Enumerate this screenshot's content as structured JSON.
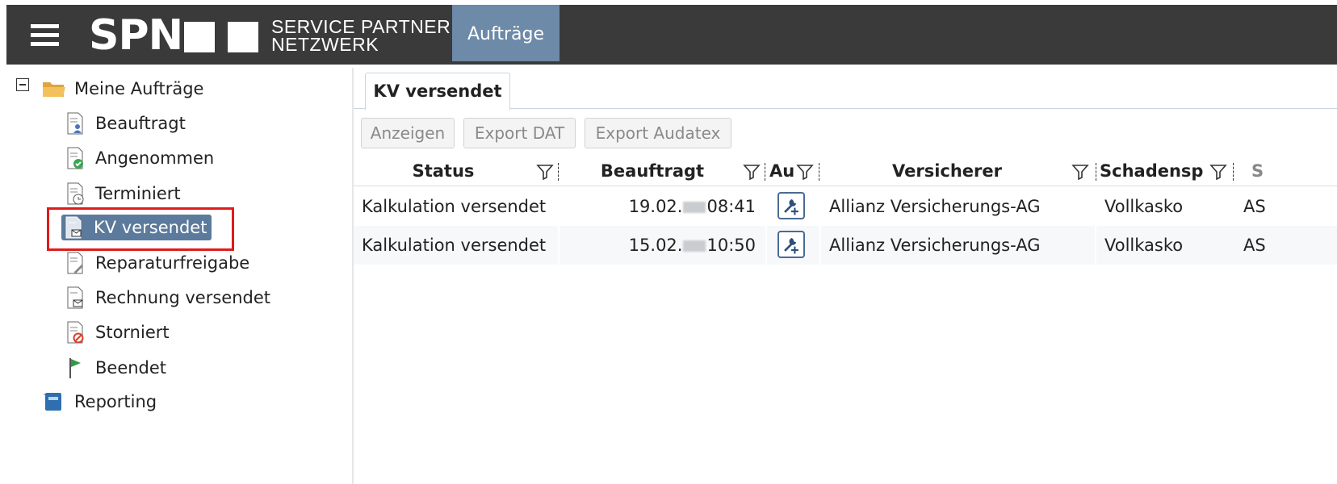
{
  "header": {
    "logo_text": "SPN",
    "logo_sub_line1": "SERVICE PARTNER",
    "logo_sub_line2": "NETZWERK",
    "nav_tab": "Aufträge"
  },
  "tree": {
    "root": "Meine Aufträge",
    "items": [
      {
        "label": "Beauftragt",
        "icon": "doc-person-icon"
      },
      {
        "label": "Angenommen",
        "icon": "doc-check-icon"
      },
      {
        "label": "Terminiert",
        "icon": "doc-clock-icon"
      },
      {
        "label": "KV versendet",
        "icon": "doc-mail-icon",
        "selected": true
      },
      {
        "label": "Reparaturfreigabe",
        "icon": "doc-pen-icon"
      },
      {
        "label": "Rechnung versendet",
        "icon": "doc-mail-icon"
      },
      {
        "label": "Storniert",
        "icon": "doc-cancel-icon"
      },
      {
        "label": "Beendet",
        "icon": "green-flag-icon"
      }
    ],
    "reporting": "Reporting"
  },
  "tab": {
    "label": "KV versendet"
  },
  "toolbar": {
    "anzeigen": "Anzeigen",
    "export_dat": "Export DAT",
    "export_audatex": "Export Audatex"
  },
  "table": {
    "columns": {
      "status": "Status",
      "beauftragt": "Beauftragt",
      "au": "Au",
      "versicherer": "Versicherer",
      "schadensparte": "Schadensp",
      "next": "S"
    },
    "rows": [
      {
        "status": "Kalkulation versendet",
        "date": "19.02.",
        "time": "08:41",
        "versicherer": "Allianz Versicherungs-AG",
        "schaden": "Vollkasko",
        "next": "AS"
      },
      {
        "status": "Kalkulation versendet",
        "date": "15.02.",
        "time": "10:50",
        "versicherer": "Allianz Versicherungs-AG",
        "schaden": "Vollkasko",
        "next": "AS"
      }
    ]
  },
  "colors": {
    "header_bg": "#3a3a3a",
    "nav_active": "#6d8aa8",
    "selected": "#5b7a9c",
    "highlight": "#e01b1b"
  }
}
